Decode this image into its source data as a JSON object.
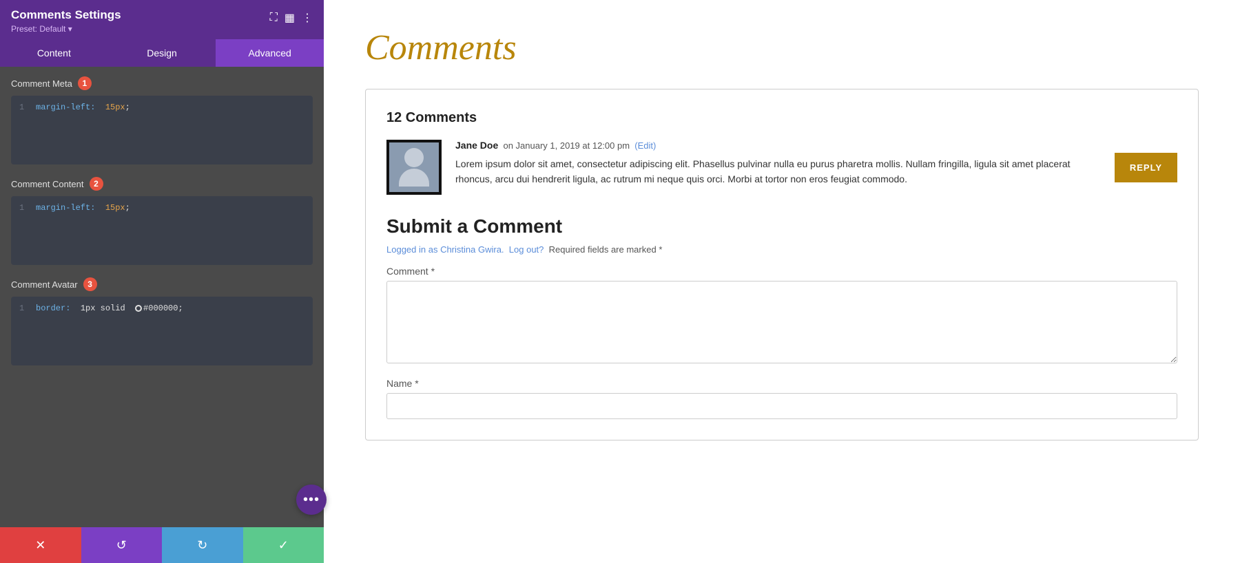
{
  "panel": {
    "title": "Comments Settings",
    "preset_label": "Preset: Default",
    "tabs": [
      {
        "id": "content",
        "label": "Content"
      },
      {
        "id": "design",
        "label": "Design"
      },
      {
        "id": "advanced",
        "label": "Advanced"
      }
    ],
    "active_tab": "advanced",
    "sections": [
      {
        "id": "comment-meta",
        "label": "Comment Meta",
        "badge": "1",
        "code_lines": [
          {
            "num": "1",
            "prop": "margin-left:",
            "val": "15px",
            "suffix": ";"
          }
        ]
      },
      {
        "id": "comment-content",
        "label": "Comment Content",
        "badge": "2",
        "code_lines": [
          {
            "num": "1",
            "prop": "margin-left:",
            "val": "15px",
            "suffix": ";"
          }
        ]
      },
      {
        "id": "comment-avatar",
        "label": "Comment Avatar",
        "badge": "3",
        "code_lines": [
          {
            "num": "1",
            "prop": "border:",
            "val": "1px solid",
            "suffix": " #000000;"
          }
        ]
      }
    ],
    "footer": {
      "cancel": "✕",
      "undo": "↺",
      "redo": "↻",
      "save": "✓"
    }
  },
  "preview": {
    "page_title": "Comments",
    "comments_count": "12 Comments",
    "comment": {
      "author": "Jane Doe",
      "meta": "on January 1, 2019 at 12:00 pm",
      "edit_label": "(Edit)",
      "text": "Lorem ipsum dolor sit amet, consectetur adipiscing elit. Phasellus pulvinar nulla eu purus pharetra mollis. Nullam fringilla, ligula sit amet placerat rhoncus, arcu dui hendrerit ligula, ac rutrum mi neque quis orci. Morbi at tortor non eros feugiat commodo.",
      "reply_label": "REPLY"
    },
    "form": {
      "title": "Submit a Comment",
      "logged_in_text": "Logged in as Christina Gwira.",
      "logout_label": "Log out?",
      "required_text": "Required fields are marked *",
      "comment_label": "Comment *",
      "name_label": "Name *"
    }
  },
  "dots_button": "•••"
}
